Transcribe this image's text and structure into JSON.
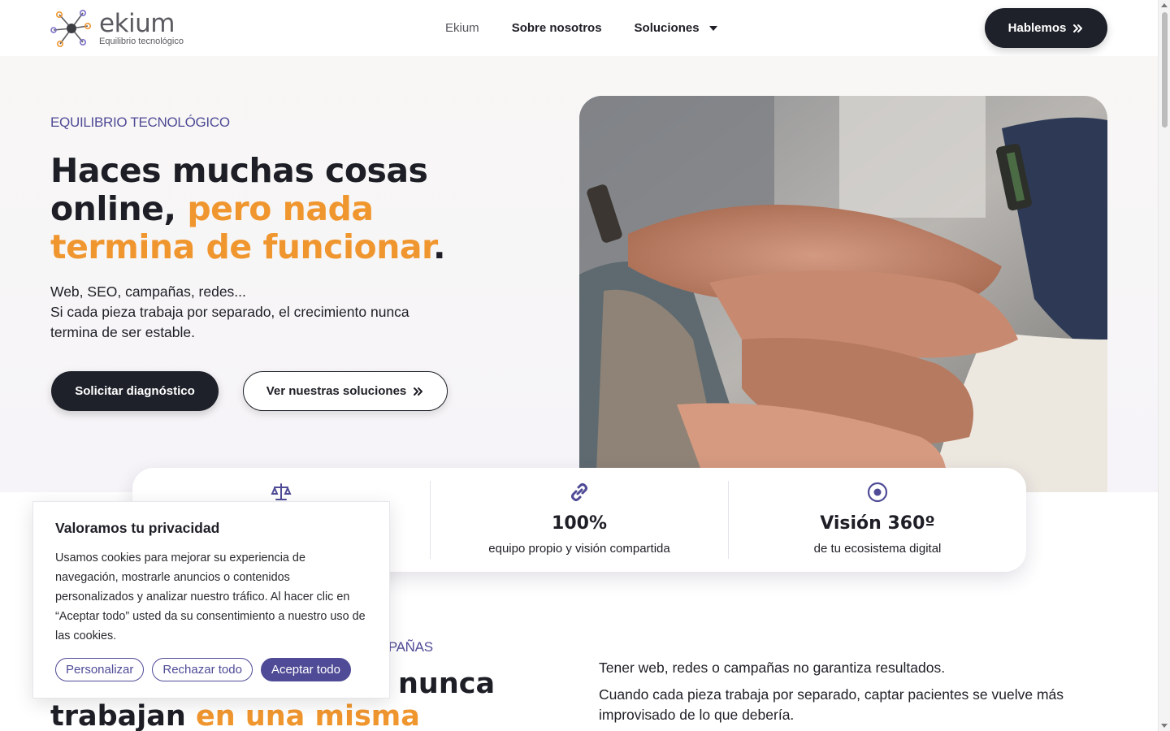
{
  "header": {
    "logo_word": "ekium",
    "logo_tagline": "Equilibrio tecnológico",
    "nav": [
      {
        "label": "Ekium"
      },
      {
        "label": "Sobre nosotros"
      },
      {
        "label": "Soluciones"
      }
    ],
    "cta_label": "Hablemos",
    "cta_icon": "double-chevron-right-icon"
  },
  "hero": {
    "eyebrow": "EQUILIBRIO TECNOLÓGICO",
    "title_part1": "Haces muchas cosas online, ",
    "title_highlight": "pero nada termina de funcionar",
    "title_end": ".",
    "subtitle_line1": "Web, SEO, campañas, redes...",
    "subtitle_line2": "Si cada pieza trabaja por separado, el crecimiento nunca termina de ser estable.",
    "primary_button": "Solicitar diagnóstico",
    "secondary_button": "Ver nuestras soluciones",
    "image_alt": "hands-stacked-teamwork-photo"
  },
  "stats": [
    {
      "icon": "scale-balance-icon",
      "value": "",
      "label": ""
    },
    {
      "icon": "link-icon",
      "value": "100%",
      "label": "equipo propio y visión compartida"
    },
    {
      "icon": "target-icon",
      "value": "Visión 360º",
      "label": "de tu ecosistema digital"
    }
  ],
  "section2": {
    "eyebrow_visible": "MPAÑAS",
    "title_line1_visible": "nunca",
    "title_line2_plain": "trabajan ",
    "title_line2_highlight": "en una misma dirección.",
    "para1": "Tener web, redes o campañas no garantiza resultados.",
    "para2": "Cuando cada pieza trabaja por separado, captar pacientes se vuelve más improvisado de lo que debería."
  },
  "cookie": {
    "title": "Valoramos tu privacidad",
    "text": "Usamos cookies para mejorar su experiencia de navegación, mostrarle anuncios o contenidos personalizados y analizar nuestro tráfico. Al hacer clic en “Aceptar todo” usted da su consentimiento a nuestro uso de las cookies.",
    "btn_customize": "Personalizar",
    "btn_reject": "Rechazar todo",
    "btn_accept": "Aceptar todo"
  },
  "colors": {
    "brand_purple": "#4f4b96",
    "brand_orange": "#f0962f",
    "dark": "#1e2129"
  }
}
